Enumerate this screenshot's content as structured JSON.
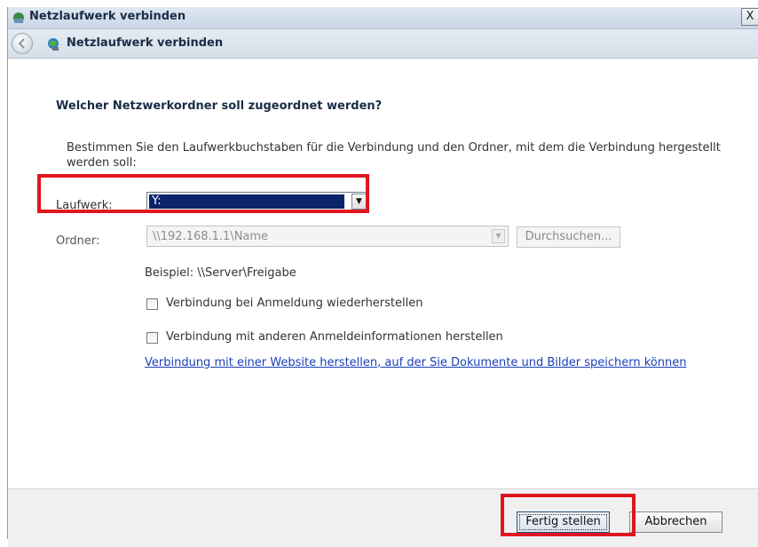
{
  "window": {
    "title": "Netzlaufwerk verbinden",
    "close_label": "X"
  },
  "nav": {
    "title": "Netzlaufwerk verbinden"
  },
  "content": {
    "heading": "Welcher Netzwerkordner soll zugeordnet werden?",
    "instruction": "Bestimmen Sie den Laufwerkbuchstaben für die Verbindung und den Ordner, mit dem die Verbindung hergestellt werden soll:",
    "drive_label": "Laufwerk:",
    "drive_value": "Y:",
    "folder_label": "Ordner:",
    "folder_value": "\\\\192.168.1.1\\Name",
    "browse_label": "Durchsuchen...",
    "example": "Beispiel: \\\\Server\\Freigabe",
    "reconnect_label": "Verbindung bei Anmeldung wiederherstellen",
    "reconnect_checked": false,
    "other_credentials_label": "Verbindung mit anderen Anmeldeinformationen herstellen",
    "other_credentials_checked": false,
    "website_link": "Verbindung mit einer Website herstellen, auf der Sie Dokumente und Bilder speichern können"
  },
  "buttons": {
    "finish": "Fertig stellen",
    "cancel": "Abbrechen"
  },
  "colors": {
    "highlight": "#e0161e",
    "selection": "#0a246a",
    "link": "#1a3fb6"
  }
}
